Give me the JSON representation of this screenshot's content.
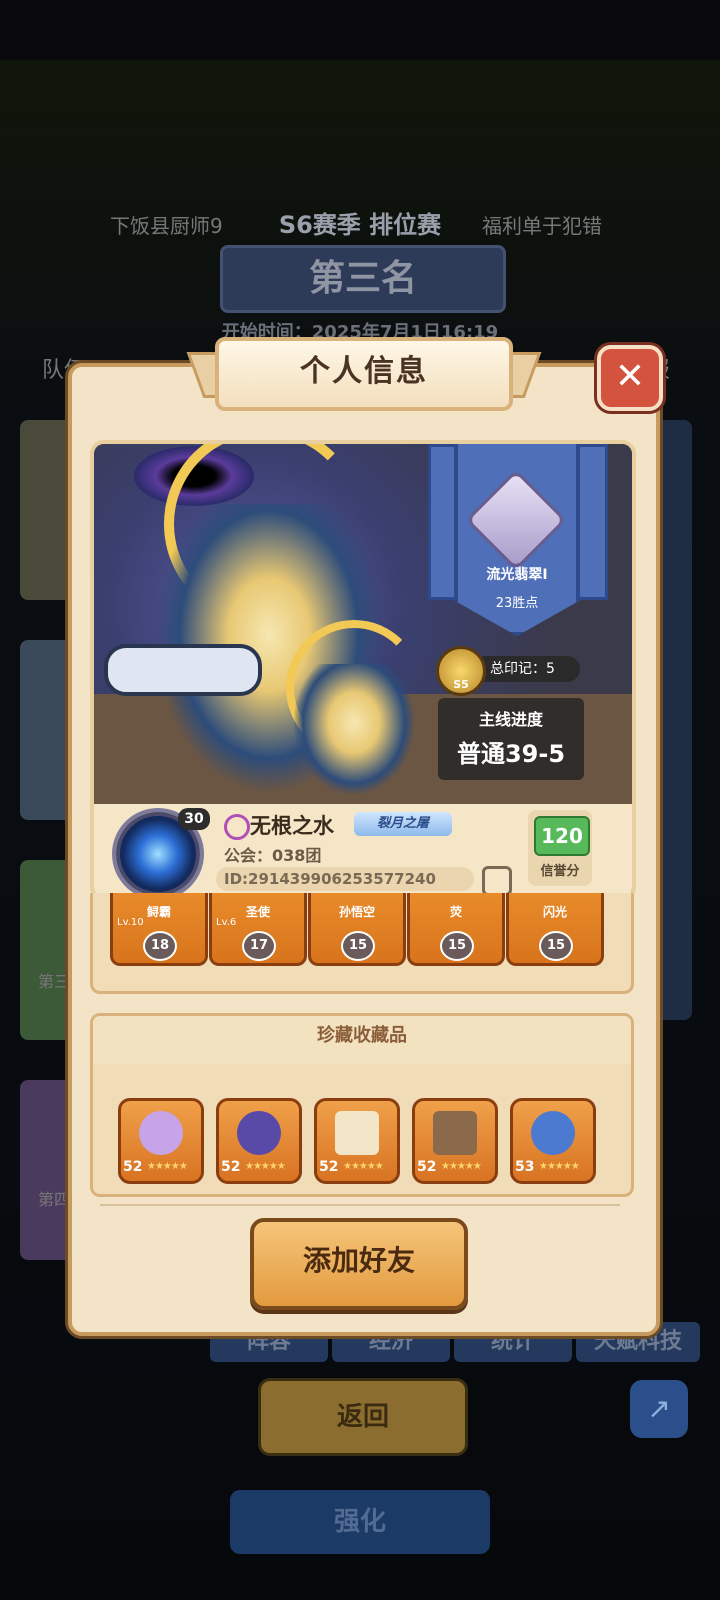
{
  "background": {
    "season_title": "S6赛季 排位赛",
    "rank_title": "第三名",
    "start_time": "开始时间：2025年7月1日16:19",
    "left_player": "下饭县厨师9",
    "right_player": "福利单于犯错",
    "tab_team": "队伍",
    "tab_report": "报",
    "bottom_tabs": [
      "阵容",
      "经济",
      "统计",
      "天赋科技"
    ],
    "back_button": "返回",
    "strengthen_button": "强化",
    "third_label": "第三名",
    "fourth_label": "第四名"
  },
  "modal": {
    "title": "个人信息",
    "close_label": "✕",
    "rank": {
      "name": "流光翡翠I",
      "points": "23胜点"
    },
    "marks": {
      "label": "总印记：",
      "value": "5",
      "badge": "S5"
    },
    "progress": {
      "label": "主线进度",
      "value": "普通39-5"
    },
    "player": {
      "level": "30",
      "name": "无根之水",
      "title_badge": "裂月之屠",
      "guild": "公会：038团",
      "id": "ID:291439906253577240"
    },
    "credit": {
      "value": "120",
      "label": "信誉分"
    },
    "heroes": [
      {
        "name": "鲟霸",
        "level": "Lv.10",
        "count": "18"
      },
      {
        "name": "圣使",
        "level": "Lv.6",
        "count": "17"
      },
      {
        "name": "孙悟空",
        "level": "",
        "count": "15"
      },
      {
        "name": "荧",
        "level": "",
        "count": "15"
      },
      {
        "name": "闪光",
        "level": "",
        "count": "15"
      }
    ],
    "collection": {
      "title": "珍藏收藏品",
      "items": [
        {
          "level": "52",
          "icon": "butterfly-icon",
          "color": "#c7a3e8"
        },
        {
          "level": "52",
          "icon": "eye-totem-icon",
          "color": "#5a4aa8"
        },
        {
          "level": "52",
          "icon": "scroll-icon",
          "color": "#f3e6c8"
        },
        {
          "level": "52",
          "icon": "hammer-icon",
          "color": "#8a6a4a"
        },
        {
          "level": "53",
          "icon": "moon-orb-icon",
          "color": "#4c7ad0"
        }
      ]
    },
    "add_friend_label": "添加好友"
  }
}
